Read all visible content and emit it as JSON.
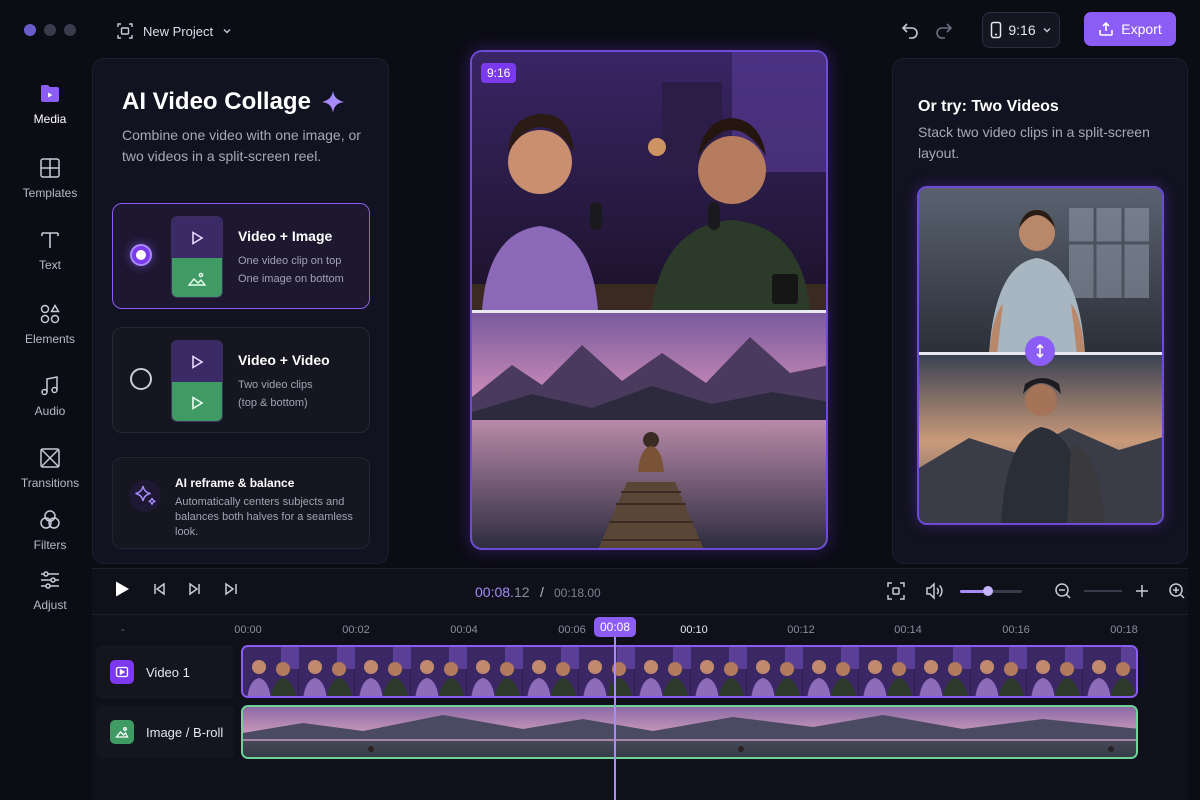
{
  "app": {
    "project_name": "New Project",
    "aspect_ratio": "9:16",
    "export_label": "Export",
    "accent_color": "#8b5cf6"
  },
  "sidebar": {
    "items": [
      {
        "label": "Media",
        "icon": "media-icon",
        "active": true
      },
      {
        "label": "Templates",
        "icon": "templates-icon"
      },
      {
        "label": "Text",
        "icon": "text-icon"
      },
      {
        "label": "Elements",
        "icon": "elements-icon"
      },
      {
        "label": "Audio",
        "icon": "audio-icon"
      },
      {
        "label": "Transitions",
        "icon": "transitions-icon"
      },
      {
        "label": "Filters",
        "icon": "filters-icon"
      },
      {
        "label": "Adjust",
        "icon": "adjust-icon"
      }
    ]
  },
  "collage_panel": {
    "title": "AI Video Collage",
    "description": "Combine one video with one image, or two videos in a split-screen reel.",
    "options": [
      {
        "title": "Video + Image",
        "line1": "One video clip on top",
        "line2": "One image on bottom",
        "selected": true
      },
      {
        "title": "Video + Video",
        "line1": "Two video clips",
        "line2": "(top & bottom)",
        "selected": false
      }
    ],
    "ai_card": {
      "title": "AI reframe & balance",
      "description": "Automatically centers subjects and balances both halves for a seamless look."
    }
  },
  "preview": {
    "badge": "9:16"
  },
  "right_panel": {
    "title": "Or try: Two Videos",
    "description": "Stack two video clips in a split-screen layout."
  },
  "timeline": {
    "current_time": "00:08.",
    "current_ms": "12",
    "separator": "/",
    "total_time": "00:18.00",
    "volume_level": 0.45,
    "playhead_label": "00:08",
    "ruler_start": "-",
    "ticks": [
      "00:00",
      "00:02",
      "00:04",
      "00:06",
      "00:08",
      "00:10",
      "00:12",
      "00:14",
      "00:16",
      "00:18"
    ],
    "tracks": [
      {
        "name": "Video 1",
        "type": "video",
        "color": "#8b5cf6"
      },
      {
        "name": "Image / B-roll",
        "type": "image",
        "color": "#6fd39a"
      }
    ]
  }
}
